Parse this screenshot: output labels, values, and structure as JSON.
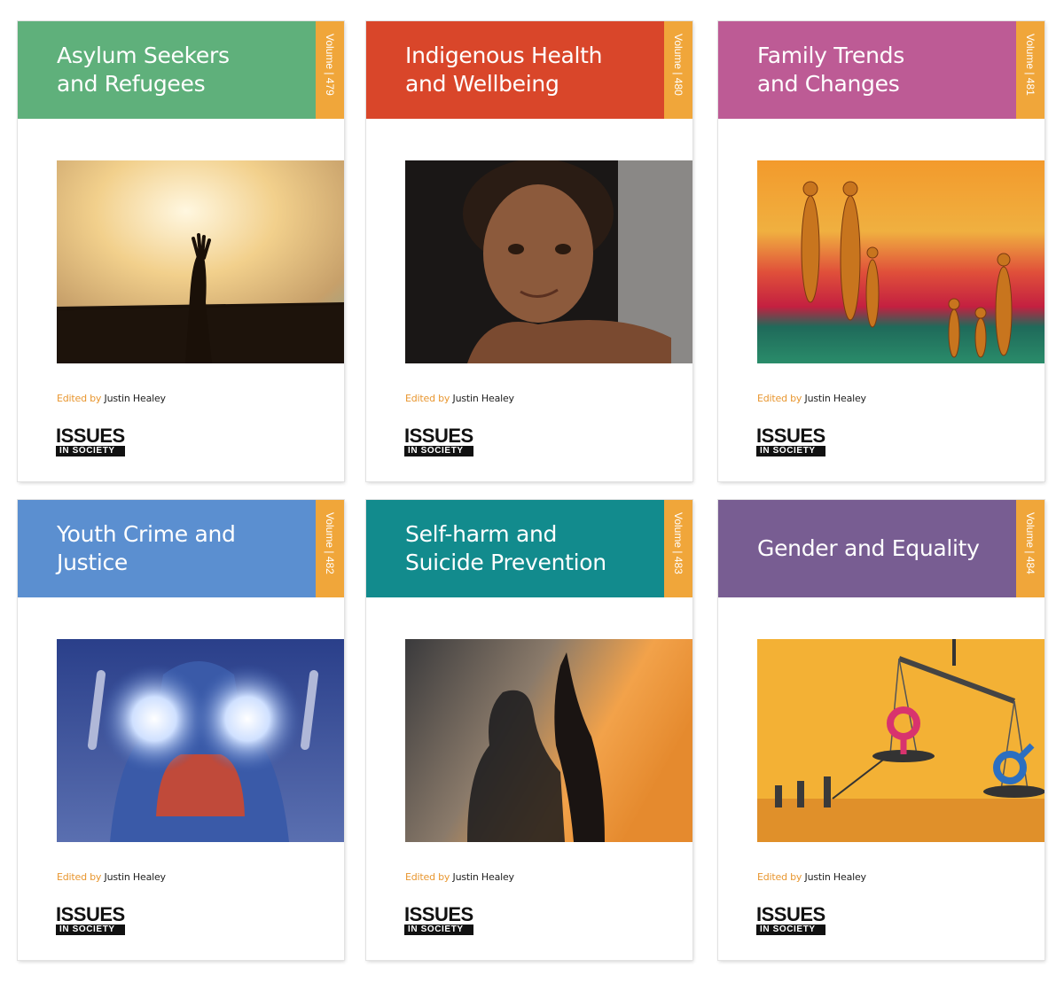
{
  "covers": [
    {
      "title_lines": [
        "Asylum Seekers",
        "and Refugees"
      ],
      "volume": "Volume | 479",
      "band_color": "#5fb07b",
      "image": "raised-hand-barbed-wire-sunset-photo",
      "editor_prefix": "Edited by",
      "editor": "Justin Healey",
      "brand_top": "ISSUES",
      "brand_bottom": "IN SOCIETY"
    },
    {
      "title_lines": [
        "Indigenous Health",
        "and Wellbeing"
      ],
      "volume": "Volume | 480",
      "band_color": "#d9462a",
      "image": "indigenous-child-portrait-photo",
      "editor_prefix": "Edited by",
      "editor": "Justin Healey",
      "brand_top": "ISSUES",
      "brand_bottom": "IN SOCIETY"
    },
    {
      "title_lines": [
        "Family Trends",
        "and Changes"
      ],
      "volume": "Volume | 481",
      "band_color": "#bd5b95",
      "image": "painted-family-figures-artwork",
      "editor_prefix": "Edited by",
      "editor": "Justin Healey",
      "brand_top": "ISSUES",
      "brand_bottom": "IN SOCIETY"
    },
    {
      "title_lines": [
        "Youth Crime and Justice"
      ],
      "volume": "Volume | 482",
      "band_color": "#5b8fd0",
      "image": "youth-hands-up-headlights-photo",
      "editor_prefix": "Edited by",
      "editor": "Justin Healey",
      "brand_top": "ISSUES",
      "brand_bottom": "IN SOCIETY"
    },
    {
      "title_lines": [
        "Self-harm and",
        "Suicide Prevention"
      ],
      "volume": "Volume | 483",
      "band_color": "#128b8d",
      "image": "two-women-silhouette-sunset-photo",
      "editor_prefix": "Edited by",
      "editor": "Justin Healey",
      "brand_top": "ISSUES",
      "brand_bottom": "IN SOCIETY"
    },
    {
      "title_lines": [
        "Gender and Equality"
      ],
      "volume": "Volume | 484",
      "band_color": "#785d92",
      "image": "gender-balance-scale-illustration",
      "editor_prefix": "Edited by",
      "editor": "Justin Healey",
      "brand_top": "ISSUES",
      "brand_bottom": "IN SOCIETY"
    }
  ],
  "volume_tab_color": "#f0a63a"
}
